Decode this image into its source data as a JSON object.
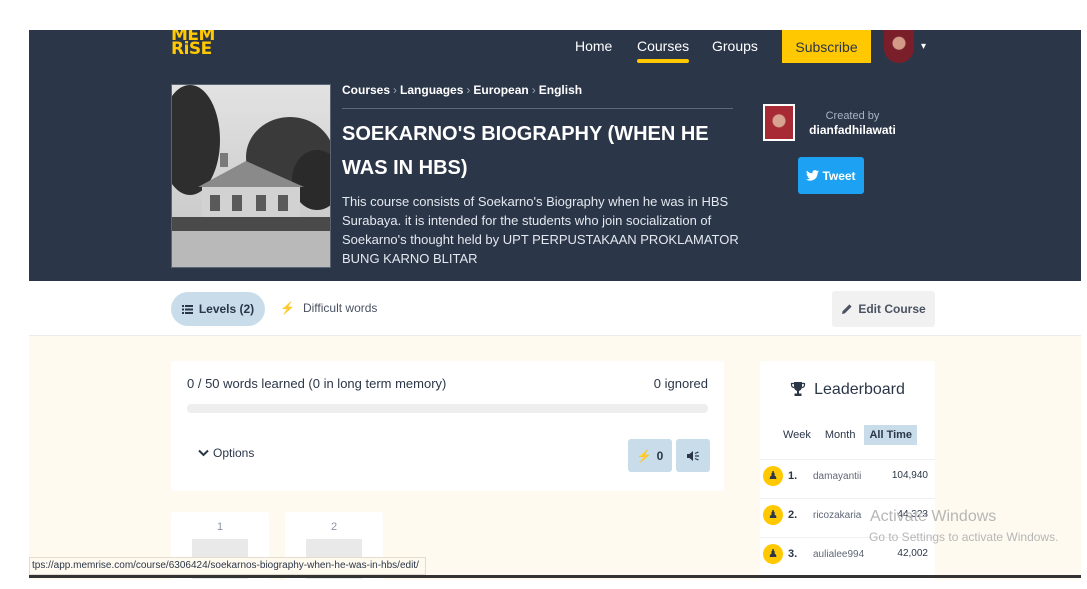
{
  "header": {
    "logo": "MEM RiSE",
    "nav": {
      "home": "Home",
      "courses": "Courses",
      "groups": "Groups"
    },
    "subscribe": "Subscribe",
    "user_menu_caret": "▾"
  },
  "course": {
    "breadcrumb": [
      "Courses",
      "Languages",
      "European",
      "English"
    ],
    "breadcrumb_separator": "›",
    "title": "SOEKARNO'S BIOGRAPHY (WHEN HE WAS IN HBS)",
    "description": "This course consists of Soekarno's Biography when he was in HBS Surabaya. it is intended for the students who join socialization of Soekarno's thought held by UPT PERPUSTAKAAN PROKLAMATOR BUNG KARNO BLITAR",
    "created_by_label": "Created by",
    "creator": "dianfadhilawati",
    "tweet_label": "Tweet"
  },
  "tabs": {
    "levels": "Levels (2)",
    "difficult_words": "Difficult words",
    "edit_course": "Edit Course"
  },
  "progress": {
    "words_learned": "0 / 50 words learned (0 in long term memory)",
    "ignored": "0 ignored",
    "fraction": 0,
    "options_label": "Options",
    "review_count": "0"
  },
  "levels": [
    {
      "number": "1"
    },
    {
      "number": "2"
    }
  ],
  "leaderboard": {
    "title": "Leaderboard",
    "periods": [
      "Week",
      "Month",
      "All Time"
    ],
    "active_period": "All Time",
    "rows": [
      {
        "rank": "1.",
        "name": "damayantii",
        "score": "104,940"
      },
      {
        "rank": "2.",
        "name": "ricozakaria",
        "score": "44,323"
      },
      {
        "rank": "3.",
        "name": "aulialee994",
        "score": "42,002"
      }
    ]
  },
  "status_bar": {
    "url": "tps://app.memrise.com/course/6306424/soekarnos-biography-when-he-was-in-hbs/edit/"
  },
  "watermark": {
    "title": "Activate Windows",
    "subtitle": "Go to Settings to activate Windows."
  },
  "colors": {
    "header_bg": "#2b3648",
    "accent_yellow": "#ffc800",
    "tweet_blue": "#1da1f2",
    "pill_blue": "#c8dde9",
    "page_bg": "#fffaf0"
  },
  "icons": {
    "levels": "list-icon",
    "difficult": "lightning-icon",
    "edit": "pencil-icon",
    "tweet": "twitter-bird-icon",
    "options": "chevron-down-icon",
    "review": "lightning-icon",
    "listen": "speaker-icon",
    "leaderboard": "trophy-icon",
    "rank": "user-medal-icon"
  }
}
